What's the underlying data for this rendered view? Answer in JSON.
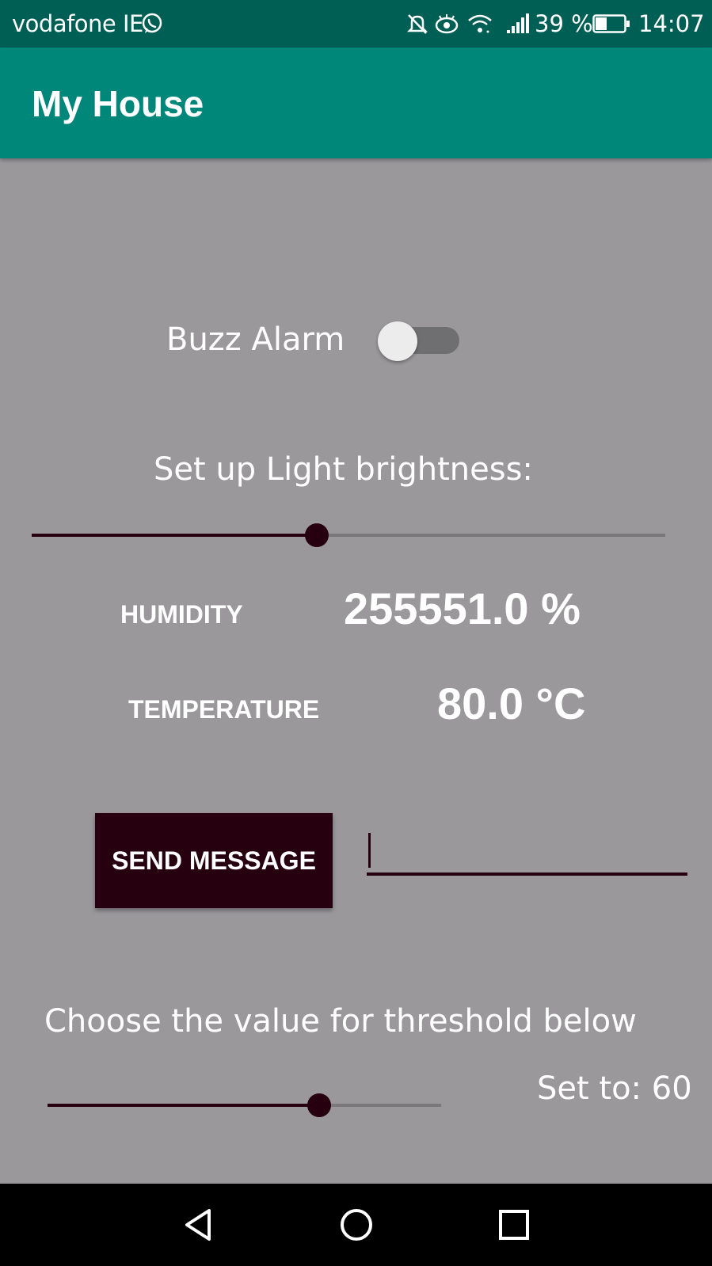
{
  "status_bar": {
    "carrier": "vodafone IE",
    "battery_percent": "39 %",
    "time": "14:07",
    "icons": [
      "whatsapp-icon",
      "mute-icon",
      "eye-icon",
      "wifi-icon",
      "signal-icon",
      "battery-icon"
    ],
    "battery_level": 0.39
  },
  "app_bar": {
    "title": "My House"
  },
  "alarm": {
    "label": "Buzz Alarm",
    "enabled": false
  },
  "brightness": {
    "label": "Set up Light brightness:",
    "level": 0.45
  },
  "metrics": {
    "humidity": {
      "label": "HUMIDITY",
      "value": "255551.0 %"
    },
    "temperature": {
      "label": "TEMPERATURE",
      "value": "80.0 °C"
    }
  },
  "message": {
    "button_label": "SEND MESSAGE",
    "input_value": ""
  },
  "threshold": {
    "label": "Choose the value for threshold below",
    "set_to": "Set to: 60",
    "value": 60,
    "level": 0.69
  },
  "nav": {
    "icons": [
      "back-icon",
      "home-icon",
      "recents-icon"
    ]
  },
  "colors": {
    "status_bar": "#005f55",
    "app_bar": "#00877a",
    "background": "#9a989b",
    "accent": "#26000f"
  }
}
